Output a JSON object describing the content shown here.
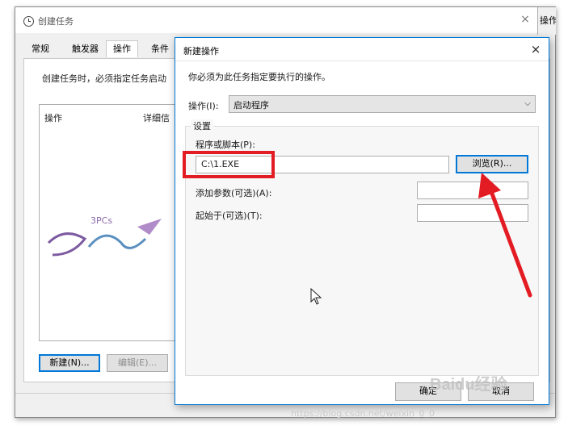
{
  "main_window": {
    "title": "创建任务",
    "close_glyph": "×",
    "partial_window_label": "操作",
    "tabs": [
      {
        "label": "常规"
      },
      {
        "label": "触发器"
      },
      {
        "label": "操作"
      },
      {
        "label": "条件"
      }
    ],
    "description": "创建任务时，必须指定任务启动",
    "table_headers": {
      "action": "操作",
      "details": "详细信"
    },
    "buttons": {
      "new": "新建(N)...",
      "edit": "编辑(E)..."
    },
    "logo_text": "3PCs"
  },
  "dialog": {
    "title": "新建操作",
    "close_glyph": "×",
    "instruction": "你必须为此任务指定要执行的操作。",
    "action_label": "操作(I):",
    "action_value": "启动程序",
    "settings_group_title": "设置",
    "program_label": "程序或脚本(P):",
    "program_value": "C:\\1.EXE",
    "browse_button": "浏览(R)...",
    "args_label": "添加参数(可选)(A):",
    "start_in_label": "起始于(可选)(T):",
    "ok_button": "确定",
    "cancel_button": "取消"
  },
  "watermarks": {
    "baidu": "Baidu经验",
    "url": "https://blog.csdn.net/weixin_0_0"
  },
  "colors": {
    "accent": "#0078d7",
    "annotation_red": "#e31b23",
    "dialog_bg": "#f0f0f0"
  },
  "icons": {
    "window_icon": "clock-icon",
    "combo_arrow": "chevron-down-icon",
    "pointer": "mouse-cursor-icon"
  }
}
